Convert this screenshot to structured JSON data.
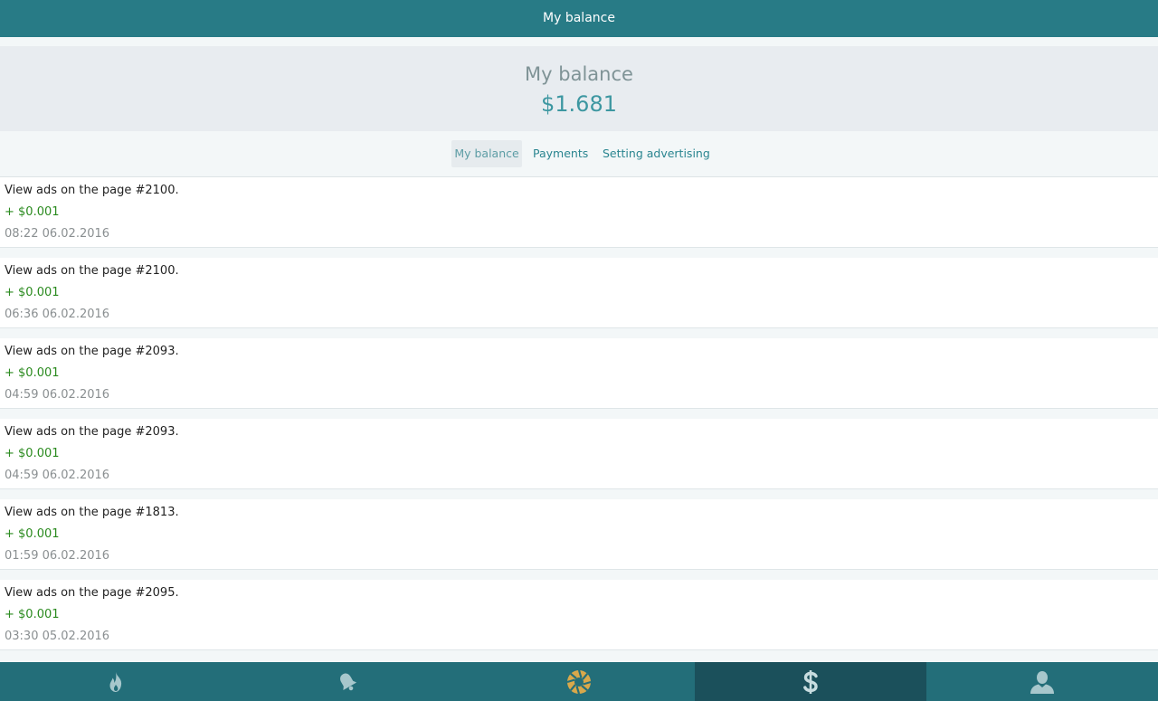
{
  "topbar": {
    "title": "My balance"
  },
  "balance": {
    "label": "My balance",
    "amount": "$1.681"
  },
  "tabs": [
    {
      "label": "My balance",
      "active": true
    },
    {
      "label": "Payments",
      "active": false
    },
    {
      "label": "Setting advertising",
      "active": false
    }
  ],
  "transactions": [
    {
      "title": "View ads on the page #2100.",
      "amount": "+ $0.001",
      "date": "08:22 06.02.2016"
    },
    {
      "title": "View ads on the page #2100.",
      "amount": "+ $0.001",
      "date": "06:36 06.02.2016"
    },
    {
      "title": "View ads on the page #2093.",
      "amount": "+ $0.001",
      "date": "04:59 06.02.2016"
    },
    {
      "title": "View ads on the page #2093.",
      "amount": "+ $0.001",
      "date": "04:59 06.02.2016"
    },
    {
      "title": "View ads on the page #1813.",
      "amount": "+ $0.001",
      "date": "01:59 06.02.2016"
    },
    {
      "title": "View ads on the page #2095.",
      "amount": "+ $0.001",
      "date": "03:30 05.02.2016"
    }
  ],
  "bottom_nav": [
    {
      "icon": "flame-icon",
      "active": false
    },
    {
      "icon": "bell-icon",
      "active": false
    },
    {
      "icon": "aperture-icon",
      "active": false
    },
    {
      "icon": "dollar-icon",
      "active": true
    },
    {
      "icon": "user-icon",
      "active": false
    }
  ],
  "colors": {
    "brand": "#287b86",
    "nav_bg": "#236e79",
    "nav_active": "#1b505b",
    "positive_amount": "#2a8a1e",
    "balance_amount": "#3d97a1"
  }
}
